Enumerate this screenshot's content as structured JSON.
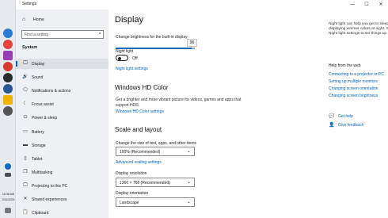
{
  "taskbar": {
    "icons": [
      {
        "name": "edge-icon",
        "color": "#2b7cd3"
      },
      {
        "name": "chrome-icon",
        "color": "#e2463a"
      },
      {
        "name": "app-icon-a",
        "color": "#9b3db3"
      },
      {
        "name": "app-icon-b",
        "color": "#d73c2c"
      },
      {
        "name": "media-icon",
        "color": "#2b2b2b"
      },
      {
        "name": "word-icon",
        "color": "#2b579a"
      },
      {
        "name": "folder-icon",
        "color": "#f0b400"
      },
      {
        "name": "settings-icon",
        "color": "#555555"
      }
    ],
    "time": "10:36 AM",
    "date": "3/11/2023"
  },
  "window": {
    "title": "Settings",
    "minimize": "—",
    "maximize": "☐",
    "close": "✕"
  },
  "nav": {
    "home_label": "Home",
    "search_placeholder": "Find a setting",
    "section": "System",
    "items": [
      {
        "label": "Display",
        "icon": "🖵"
      },
      {
        "label": "Sound",
        "icon": "🔊"
      },
      {
        "label": "Notifications & actions",
        "icon": "🗨"
      },
      {
        "label": "Focus assist",
        "icon": "☾"
      },
      {
        "label": "Power & sleep",
        "icon": "⏻"
      },
      {
        "label": "Battery",
        "icon": "▭"
      },
      {
        "label": "Storage",
        "icon": "▬"
      },
      {
        "label": "Tablet",
        "icon": "▯"
      },
      {
        "label": "Multitasking",
        "icon": "❐"
      },
      {
        "label": "Projecting to this PC",
        "icon": "🖵"
      },
      {
        "label": "Shared experiences",
        "icon": "✕"
      },
      {
        "label": "Clipboard",
        "icon": "📋"
      }
    ]
  },
  "main": {
    "title": "Display",
    "brightness_label": "Change brightness for the built-in display",
    "brightness_value": "96",
    "brightness_level": 96,
    "night_light_label": "Night light",
    "night_light_state": "Off",
    "night_light_settings": "Night light settings",
    "hd_title": "Windows HD Color",
    "hd_desc": "Get a brighter and more vibrant picture for videos, games and apps that support HDR.",
    "hd_link": "Windows HD Color settings",
    "scale_title": "Scale and layout",
    "scale_label": "Change the size of text, apps, and other items",
    "scale_value": "100% (Recommended)",
    "advanced_scaling": "Advanced scaling settings",
    "resolution_label": "Display resolution",
    "resolution_value": "1366 × 768 (Recommended)",
    "orientation_label": "Display orientation",
    "orientation_value": "Landscape"
  },
  "right": {
    "description": "Night light can help you get to sleep by displaying warmer colors at night. Select Night light settings to set things up.",
    "help_title": "Help from the web",
    "links": [
      "Connecting to a projector or PC",
      "Setting up multiple monitors",
      "Changing screen orientation",
      "Changing screen brightness"
    ],
    "get_help": "Get help",
    "give_feedback": "Give feedback"
  },
  "colors": {
    "accent": "#0067c0",
    "nav_bg": "#eef0f3"
  }
}
